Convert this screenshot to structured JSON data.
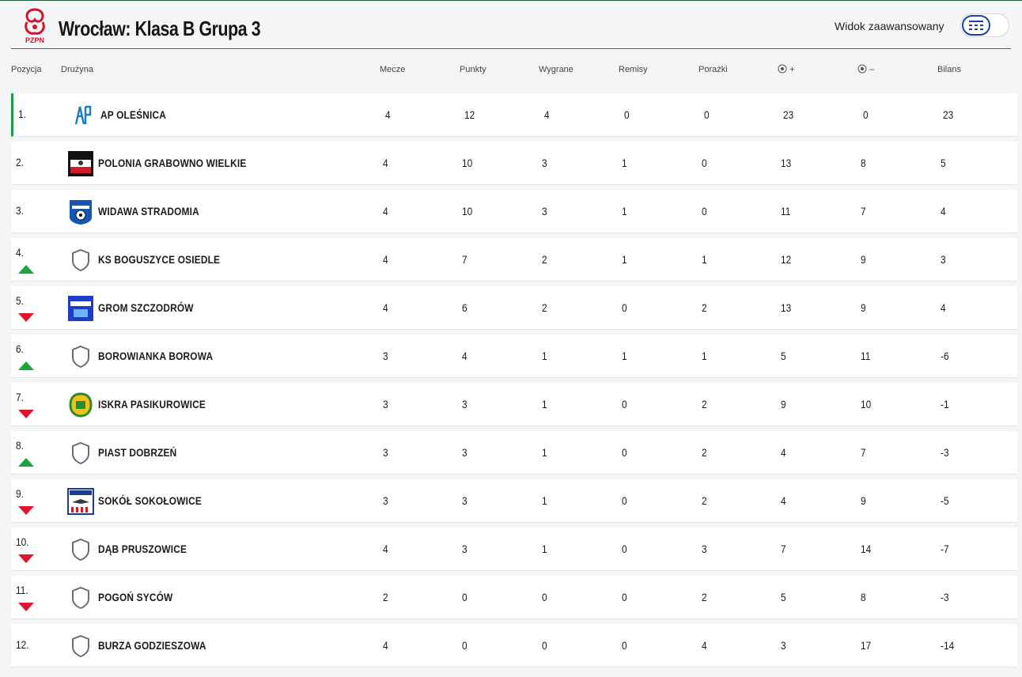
{
  "header": {
    "title": "Wrocław: Klasa B Grupa 3",
    "logo_text": "PZPN",
    "advanced_view_label": "Widok zaawansowany"
  },
  "columns": [
    "Pozycja",
    "Drużyna",
    "Mecze",
    "Punkty",
    "Wygrane",
    "Remisy",
    "Porażki",
    "+",
    "–",
    "Bilans"
  ],
  "colors": {
    "accent": "#2f7d4f",
    "up": "#1aa53b",
    "down": "#e0142c",
    "toggle": "#1d3fae"
  },
  "rows": [
    {
      "pos": "1.",
      "team": "AP OLEŚNICA",
      "crest": "ap-olesnica-crest",
      "trend": "none",
      "m": "4",
      "pts": "12",
      "w": "4",
      "d": "0",
      "l": "0",
      "gf": "23",
      "ga": "0",
      "diff": "23"
    },
    {
      "pos": "2.",
      "team": "POLONIA GRABOWNO WIELKIE",
      "crest": "polonia-crest",
      "trend": "none",
      "m": "4",
      "pts": "10",
      "w": "3",
      "d": "1",
      "l": "0",
      "gf": "13",
      "ga": "8",
      "diff": "5"
    },
    {
      "pos": "3.",
      "team": "WIDAWA STRADOMIA",
      "crest": "widawa-crest",
      "trend": "none",
      "m": "4",
      "pts": "10",
      "w": "3",
      "d": "1",
      "l": "0",
      "gf": "11",
      "ga": "7",
      "diff": "4"
    },
    {
      "pos": "4.",
      "team": "KS BOGUSZYCE OSIEDLE",
      "crest": "default-shield",
      "trend": "up",
      "m": "4",
      "pts": "7",
      "w": "2",
      "d": "1",
      "l": "1",
      "gf": "12",
      "ga": "9",
      "diff": "3"
    },
    {
      "pos": "5.",
      "team": "GROM SZCZODRÓW",
      "crest": "grom-crest",
      "trend": "down",
      "m": "4",
      "pts": "6",
      "w": "2",
      "d": "0",
      "l": "2",
      "gf": "13",
      "ga": "9",
      "diff": "4"
    },
    {
      "pos": "6.",
      "team": "BOROWIANKA BOROWA",
      "crest": "default-shield",
      "trend": "up",
      "m": "3",
      "pts": "4",
      "w": "1",
      "d": "1",
      "l": "1",
      "gf": "5",
      "ga": "11",
      "diff": "-6"
    },
    {
      "pos": "7.",
      "team": "ISKRA PASIKUROWICE",
      "crest": "iskra-crest",
      "trend": "down",
      "m": "3",
      "pts": "3",
      "w": "1",
      "d": "0",
      "l": "2",
      "gf": "9",
      "ga": "10",
      "diff": "-1"
    },
    {
      "pos": "8.",
      "team": "PIAST DOBRZEŃ",
      "crest": "default-shield",
      "trend": "up",
      "m": "3",
      "pts": "3",
      "w": "1",
      "d": "0",
      "l": "2",
      "gf": "4",
      "ga": "7",
      "diff": "-3"
    },
    {
      "pos": "9.",
      "team": "SOKÓŁ SOKOŁOWICE",
      "crest": "sokol-crest",
      "trend": "down",
      "m": "3",
      "pts": "3",
      "w": "1",
      "d": "0",
      "l": "2",
      "gf": "4",
      "ga": "9",
      "diff": "-5"
    },
    {
      "pos": "10.",
      "team": "DĄB PRUSZOWICE",
      "crest": "default-shield",
      "trend": "down",
      "m": "4",
      "pts": "3",
      "w": "1",
      "d": "0",
      "l": "3",
      "gf": "7",
      "ga": "14",
      "diff": "-7"
    },
    {
      "pos": "11.",
      "team": "POGOŃ SYCÓW",
      "crest": "default-shield",
      "trend": "down",
      "m": "2",
      "pts": "0",
      "w": "0",
      "d": "0",
      "l": "2",
      "gf": "5",
      "ga": "8",
      "diff": "-3"
    },
    {
      "pos": "12.",
      "team": "BURZA GODZIESZOWA",
      "crest": "default-shield",
      "trend": "none",
      "m": "4",
      "pts": "0",
      "w": "0",
      "d": "0",
      "l": "4",
      "gf": "3",
      "ga": "17",
      "diff": "-14"
    }
  ]
}
